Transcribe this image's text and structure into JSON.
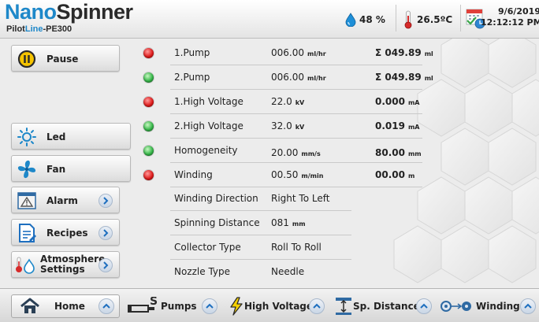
{
  "header": {
    "brand_part1": "Nano",
    "brand_part2": "Spinner",
    "subbrand_part1": "Pilot",
    "subbrand_part2": "Line",
    "subbrand_part3": "-PE300",
    "humidity": "48 %",
    "temperature": "26.5ºC",
    "date": "9/6/2019",
    "time": "12:12:12 PM"
  },
  "left_buttons": {
    "pause": "Pause",
    "led": "Led",
    "fan": "Fan",
    "alarm": "Alarm",
    "recipes": "Recipes",
    "atmosphere_line1": "Atmosphere",
    "atmosphere_line2": "Settings"
  },
  "rows": [
    {
      "status": "red",
      "name": "1.Pump",
      "value": "006.00",
      "value_unit": "ml/hr",
      "total": "Σ 049.89",
      "total_unit": "ml"
    },
    {
      "status": "green",
      "name": "2.Pump",
      "value": "006.00",
      "value_unit": "ml/hr",
      "total": "Σ 049.89",
      "total_unit": "ml"
    },
    {
      "status": "red",
      "name": "1.High Voltage",
      "value": "22.0",
      "value_unit": "kV",
      "total": "0.000",
      "total_unit": "mA"
    },
    {
      "status": "green",
      "name": "2.High Voltage",
      "value": "32.0",
      "value_unit": "kV",
      "total": "0.019",
      "total_unit": "mA"
    },
    {
      "status": "green",
      "name": "Homogeneity",
      "value": "20.00",
      "value_unit": "mm/s",
      "total": "80.00",
      "total_unit": "mm"
    },
    {
      "status": "red",
      "name": "Winding",
      "value": "00.50",
      "value_unit": "m/min",
      "total": "00.00",
      "total_unit": "m"
    },
    {
      "name": "Winding Direction",
      "value": "Right To Left"
    },
    {
      "name": "Spinning Distance",
      "value": "081",
      "value_unit": "mm"
    },
    {
      "name": "Collector Type",
      "value": "Roll To Roll"
    },
    {
      "name": "Nozzle Type",
      "value": "Needle"
    }
  ],
  "bottom_tabs": {
    "home": "Home",
    "pumps": "Pumps",
    "high_voltage": "High Voltage",
    "sp_distance": "Sp. Distance",
    "winding": "Winding"
  },
  "colors": {
    "brand_blue": "#1e88c9",
    "led_red": "#e01e1e",
    "led_green": "#37b84a"
  }
}
